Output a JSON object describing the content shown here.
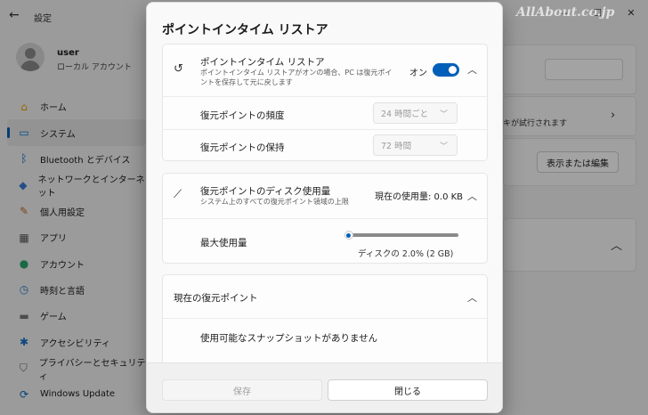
{
  "app": {
    "title": "設定",
    "watermark": "AllAbout.co.jp"
  },
  "user": {
    "name": "user",
    "account_type": "ローカル アカウント"
  },
  "nav": {
    "items": [
      {
        "label": "ホーム",
        "icon": "home-icon",
        "glyph": "⌂",
        "color": "#e8a000",
        "active": false
      },
      {
        "label": "システム",
        "icon": "display-icon",
        "glyph": "▭",
        "color": "#0078d4",
        "active": true
      },
      {
        "label": "Bluetooth とデバイス",
        "icon": "bluetooth-icon",
        "glyph": "ᛒ",
        "color": "#0067c0",
        "active": false
      },
      {
        "label": "ネットワークとインターネット",
        "icon": "wifi-icon",
        "glyph": "◆",
        "color": "#3a7bd5",
        "active": false
      },
      {
        "label": "個人用設定",
        "icon": "brush-icon",
        "glyph": "✎",
        "color": "#c06a2a",
        "active": false
      },
      {
        "label": "アプリ",
        "icon": "apps-icon",
        "glyph": "▦",
        "color": "#555555",
        "active": false
      },
      {
        "label": "アカウント",
        "icon": "person-icon",
        "glyph": "●",
        "color": "#2aa36b",
        "active": false
      },
      {
        "label": "時刻と言語",
        "icon": "globe-clock-icon",
        "glyph": "◷",
        "color": "#1f7ac7",
        "active": false
      },
      {
        "label": "ゲーム",
        "icon": "gamepad-icon",
        "glyph": "▬",
        "color": "#777777",
        "active": false
      },
      {
        "label": "アクセシビリティ",
        "icon": "accessibility-icon",
        "glyph": "✱",
        "color": "#1a6fc4",
        "active": false
      },
      {
        "label": "プライバシーとセキュリティ",
        "icon": "shield-icon",
        "glyph": "⛉",
        "color": "#6b6b6b",
        "active": false
      },
      {
        "label": "Windows Update",
        "icon": "update-icon",
        "glyph": "⟳",
        "color": "#0067c0",
        "active": false
      }
    ]
  },
  "background": {
    "partial_text": "キが試行されます",
    "show_edit_button": "表示または編集"
  },
  "dialog": {
    "title": "ポイントインタイム リストア",
    "pitr": {
      "title": "ポイントインタイム リストア",
      "description": "ポイントインタイム リストアがオンの場合、PC は復元ポイントを保存して元に戻します",
      "toggle_label": "オン",
      "toggle_on": true,
      "frequency_label": "復元ポイントの頻度",
      "frequency_value": "24 時間ごと",
      "retention_label": "復元ポイントの保持",
      "retention_value": "72 時間"
    },
    "disk": {
      "title": "復元ポイントのディスク使用量",
      "description": "システム上のすべての復元ポイント領域の上限",
      "current_usage": "現在の使用量: 0.0 KB",
      "max_label": "最大使用量",
      "slider_value_percent": 2.0,
      "slider_caption": "ディスクの 2.0% (2 GB)"
    },
    "current": {
      "title": "現在の復元ポイント",
      "empty_message": "使用可能なスナップショットがありません"
    },
    "footer": {
      "save_label": "保存",
      "close_label": "閉じる"
    }
  },
  "colors": {
    "accent": "#005fb8"
  }
}
